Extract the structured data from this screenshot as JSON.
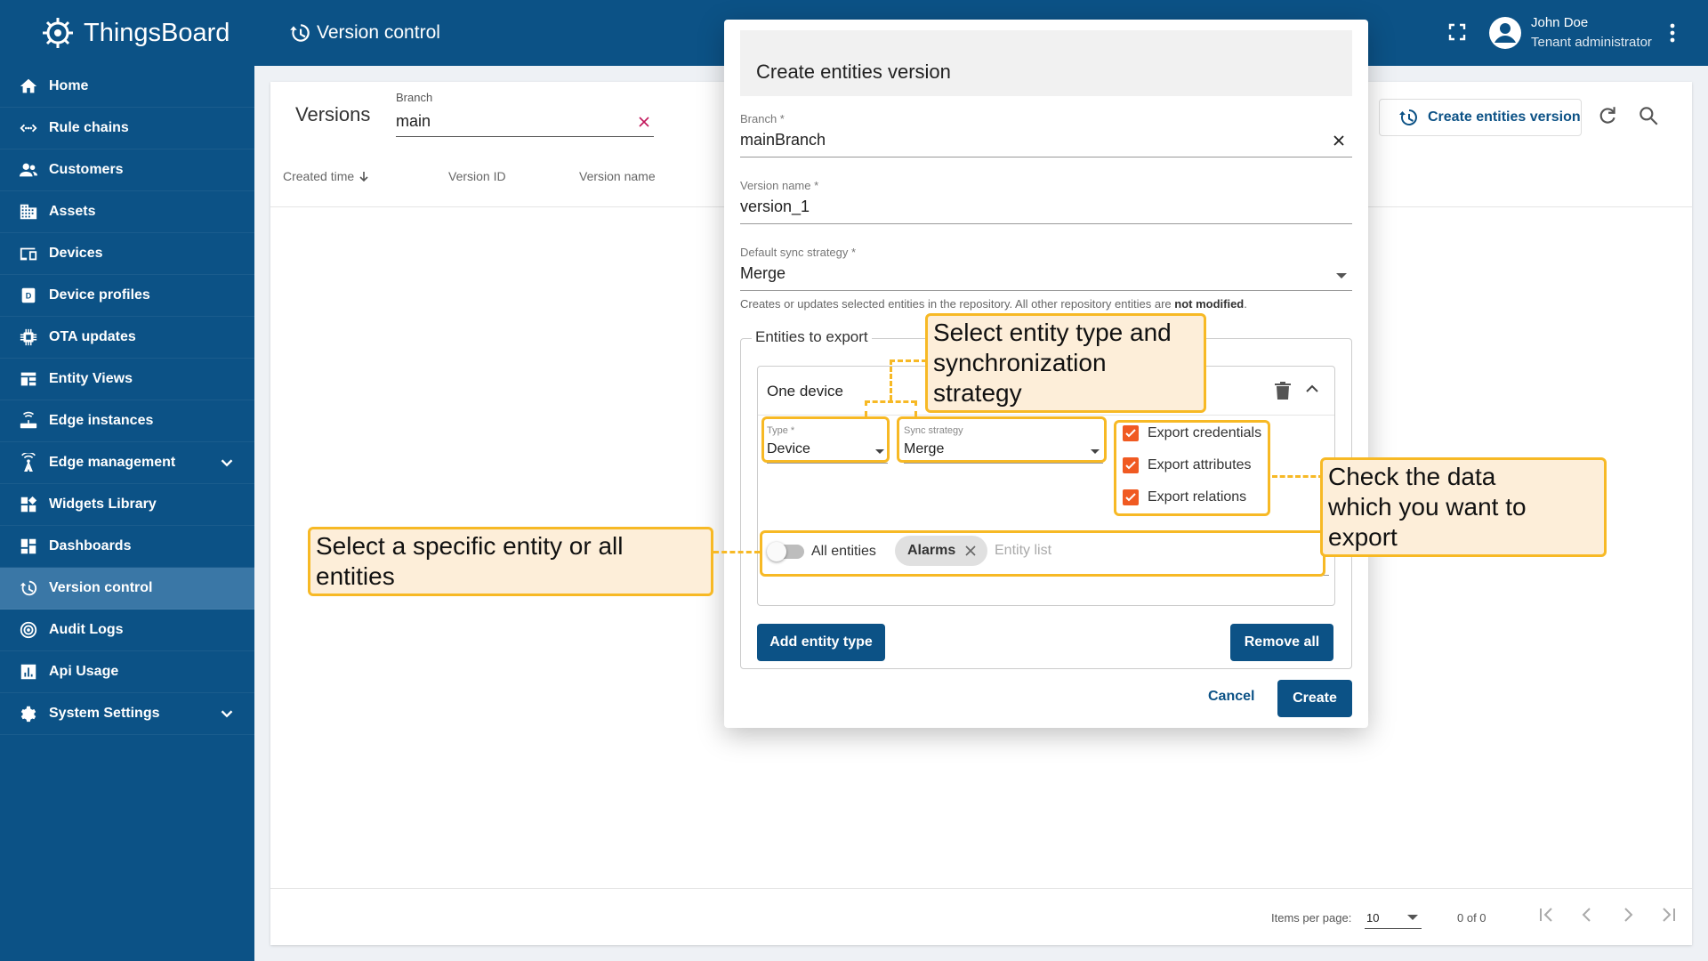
{
  "app": {
    "brand": "ThingsBoard",
    "page_title": "Version control",
    "user_name": "John Doe",
    "user_role": "Tenant administrator"
  },
  "sidebar": {
    "items": [
      {
        "label": "Home",
        "icon": "home-icon"
      },
      {
        "label": "Rule chains",
        "icon": "rule-chains-icon"
      },
      {
        "label": "Customers",
        "icon": "customers-icon"
      },
      {
        "label": "Assets",
        "icon": "assets-icon"
      },
      {
        "label": "Devices",
        "icon": "devices-icon"
      },
      {
        "label": "Device profiles",
        "icon": "device-profiles-icon"
      },
      {
        "label": "OTA updates",
        "icon": "ota-updates-icon"
      },
      {
        "label": "Entity Views",
        "icon": "entity-views-icon"
      },
      {
        "label": "Edge instances",
        "icon": "edge-instances-icon"
      },
      {
        "label": "Edge management",
        "icon": "edge-management-icon"
      },
      {
        "label": "Widgets Library",
        "icon": "widgets-library-icon"
      },
      {
        "label": "Dashboards",
        "icon": "dashboards-icon"
      },
      {
        "label": "Version control",
        "icon": "version-control-icon"
      },
      {
        "label": "Audit Logs",
        "icon": "audit-logs-icon"
      },
      {
        "label": "Api Usage",
        "icon": "api-usage-icon"
      },
      {
        "label": "System Settings",
        "icon": "system-settings-icon"
      }
    ]
  },
  "versions": {
    "title": "Versions",
    "branch_label": "Branch",
    "branch_value": "main",
    "columns": [
      "Created time",
      "Version ID",
      "Version name"
    ],
    "create_button": "Create entities version",
    "items_per_page_label": "Items per page:",
    "items_per_page": "10",
    "range": "0 of 0"
  },
  "dialog": {
    "title": "Create entities version",
    "branch_label": "Branch *",
    "branch_value": "mainBranch",
    "version_name_label": "Version name *",
    "version_name_value": "version_1",
    "sync_label": "Default sync strategy *",
    "sync_value": "Merge",
    "hint_prefix": "Creates or updates selected entities in the repository. All other repository entities are ",
    "hint_bold": "not modified",
    "hint_suffix": ".",
    "entities_legend": "Entities to export",
    "card_title": "One device",
    "type_label": "Type *",
    "type_value": "Device",
    "card_sync_label": "Sync strategy",
    "card_sync_value": "Merge",
    "export_credentials": "Export credentials",
    "export_attributes": "Export attributes",
    "export_relations": "Export relations",
    "all_entities": "All entities",
    "chip": "Alarms",
    "entity_list_placeholder": "Entity list",
    "add_entity_type": "Add entity type",
    "remove_all": "Remove all",
    "cancel": "Cancel",
    "create": "Create"
  },
  "callouts": {
    "entity_type": "Select entity type and synchronization strategy",
    "entity_type_line1": "Select entity type and",
    "entity_type_line2": "synchronization strategy",
    "check_data_line1": "Check the data",
    "check_data_line2": "which you want to export",
    "specific_entity": "Select a specific entity or all entities"
  },
  "colors": {
    "primary": "#0c5286",
    "active_nav": "#3a77a6",
    "checkbox": "#f05a22",
    "callout_border": "#f7b925",
    "callout_bg": "#fdeed9"
  }
}
